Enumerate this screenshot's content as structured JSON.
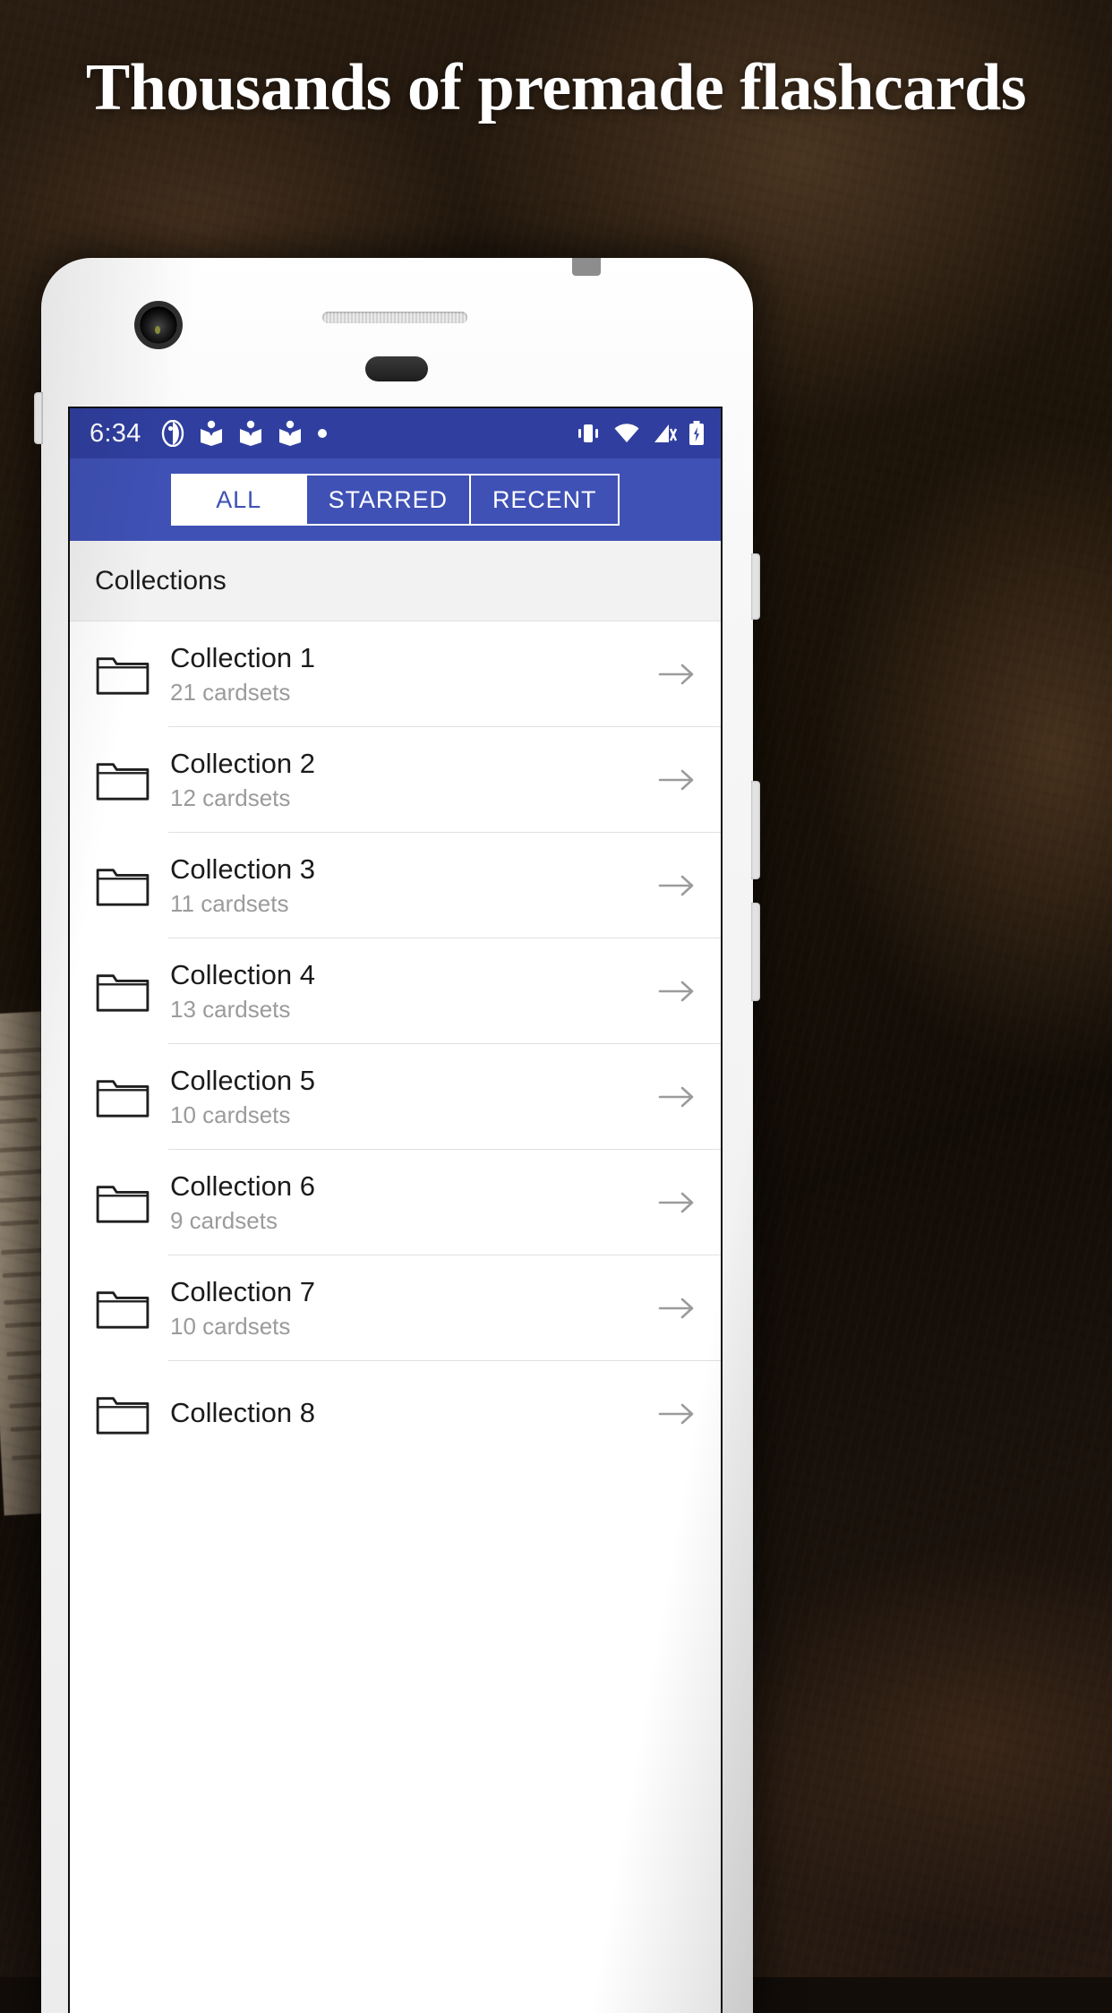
{
  "headline": "Thousands of premade flashcards",
  "colors": {
    "statusbar": "#303f9f",
    "appbar": "#3f51b5",
    "tab_active_text": "#3f51b5",
    "section_header_bg": "#f2f2f2",
    "subtitle_text": "#9b9b9b"
  },
  "phone": {
    "statusbar": {
      "time": "6:34",
      "notification_icons": [
        "app-badge-icon",
        "book-icon",
        "book-icon",
        "book-icon",
        "dot-icon"
      ],
      "system_icons": [
        "vibrate-icon",
        "wifi-icon",
        "signal-off-icon",
        "battery-charging-icon"
      ]
    },
    "tabs": [
      {
        "label": "ALL",
        "active": true
      },
      {
        "label": "STARRED",
        "active": false
      },
      {
        "label": "RECENT",
        "active": false
      }
    ],
    "section_header": "Collections",
    "collections": [
      {
        "title": "Collection 1",
        "subtitle": "21 cardsets"
      },
      {
        "title": "Collection 2",
        "subtitle": "12 cardsets"
      },
      {
        "title": "Collection 3",
        "subtitle": "11 cardsets"
      },
      {
        "title": "Collection 4",
        "subtitle": "13 cardsets"
      },
      {
        "title": "Collection 5",
        "subtitle": "10 cardsets"
      },
      {
        "title": "Collection 6",
        "subtitle": "9 cardsets"
      },
      {
        "title": "Collection 7",
        "subtitle": "10 cardsets"
      },
      {
        "title": "Collection 8",
        "subtitle": ""
      }
    ]
  }
}
